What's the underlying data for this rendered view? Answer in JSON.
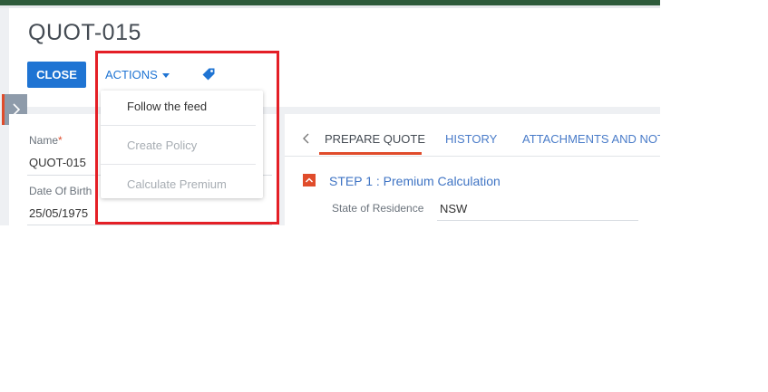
{
  "record": {
    "title": "QUOT-015"
  },
  "toolbar": {
    "close_label": "CLOSE",
    "actions_label": "ACTIONS"
  },
  "actions_menu": {
    "items": [
      {
        "label": "Follow the feed",
        "enabled": true
      },
      {
        "label": "Create Policy",
        "enabled": false
      },
      {
        "label": "Calculate Premium",
        "enabled": false
      }
    ]
  },
  "fields": {
    "name_label": "Name",
    "name_required_mark": "*",
    "name_value": "QUOT-015",
    "dob_label": "Date Of Birth",
    "dob_value": "25/05/1975"
  },
  "tabs": [
    {
      "label": "PREPARE QUOTE",
      "active": true
    },
    {
      "label": "HISTORY",
      "active": false
    },
    {
      "label": "ATTACHMENTS AND NOT",
      "active": false
    }
  ],
  "step": {
    "title": "STEP 1 : Premium Calculation",
    "field_label": "State of Residence",
    "field_value": "NSW"
  },
  "colors": {
    "primary": "#1f74d3",
    "accent": "#e04c2b",
    "highlight": "#e41f26",
    "link": "#4a7cc9",
    "disabled_text": "#a7adb3"
  },
  "icons": {
    "tag": "tag-icon",
    "caret": "caret-down-icon",
    "side_toggle": "chevron-right-icon",
    "tab_scroll": "chevron-left-icon",
    "step_collapse": "chevron-up-icon"
  }
}
